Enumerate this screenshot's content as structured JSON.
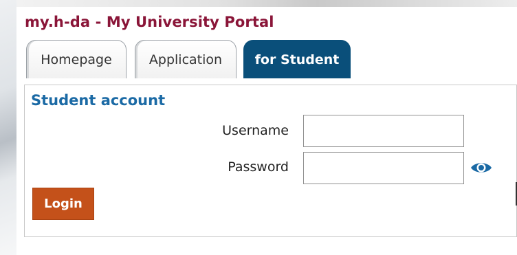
{
  "header": {
    "portal_title": "my.h-da - My University Portal"
  },
  "tabs": [
    {
      "label": "Homepage",
      "active": false
    },
    {
      "label": "Application",
      "active": false
    },
    {
      "label": "for Student",
      "active": true
    }
  ],
  "login_panel": {
    "title": "Student account",
    "username_label": "Username",
    "username_value": "",
    "password_label": "Password",
    "password_value": "",
    "show_password_icon": "eye-icon",
    "login_button_label": "Login"
  },
  "colors": {
    "title": "#8a1538",
    "active_tab": "#0a4f7a",
    "panel_title": "#1b6aa5",
    "login_button": "#c4511a",
    "eye_icon": "#1b6aa5"
  }
}
